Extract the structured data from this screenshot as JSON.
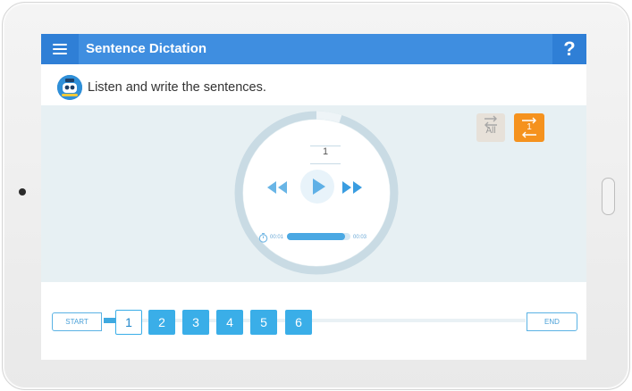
{
  "header": {
    "title": "Sentence Dictation",
    "help_label": "?"
  },
  "instruction": {
    "text": "Listen and write the sentences."
  },
  "repeat": {
    "all_label": "All",
    "one_label": "1"
  },
  "player": {
    "sentence_number": "1",
    "elapsed": "00:01",
    "duration": "00:03",
    "progress": 0.92,
    "ring_progress": 0.95
  },
  "navigation": {
    "start_label": "START",
    "end_label": "END",
    "pages": [
      "1",
      "2",
      "3",
      "4",
      "5",
      "6"
    ],
    "active_page": "1"
  },
  "colors": {
    "header": "#3f8ee0",
    "page_button": "#3aaee8",
    "repeat_active": "#f5921e",
    "stage_bg": "#e7f0f3"
  }
}
